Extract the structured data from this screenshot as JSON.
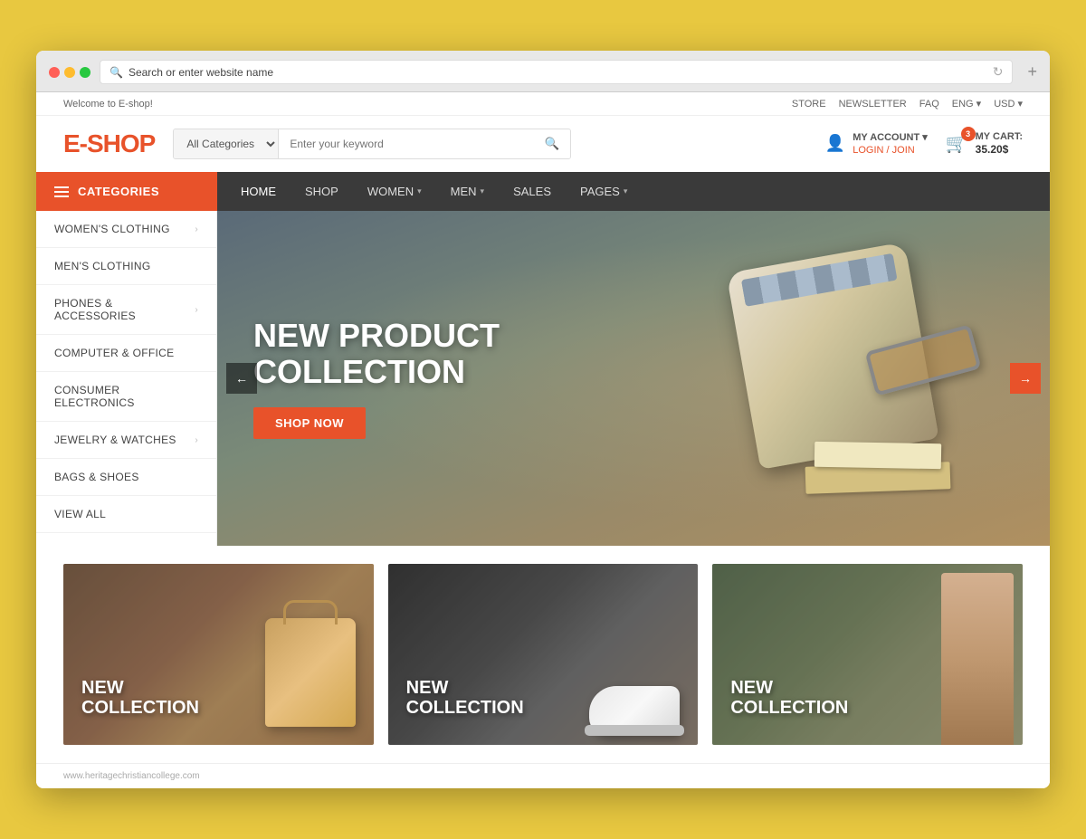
{
  "browser": {
    "url": "Search or enter website name"
  },
  "topbar": {
    "welcome": "Welcome to E-shop!",
    "store": "STORE",
    "newsletter": "NEWSLETTER",
    "faq": "FAQ",
    "lang": "ENG",
    "currency": "USD"
  },
  "header": {
    "logo_e": "E-",
    "logo_shop": "SHOP",
    "category_default": "All Categories",
    "search_placeholder": "Enter your keyword",
    "account_label": "MY ACCOUNT",
    "account_sub": "LOGIN / JOIN",
    "cart_label": "MY CART:",
    "cart_price": "35.20$",
    "cart_count": "3"
  },
  "nav": {
    "categories": "CATEGORIES",
    "links": [
      {
        "label": "HOME",
        "has_arrow": false
      },
      {
        "label": "SHOP",
        "has_arrow": false
      },
      {
        "label": "WOMEN",
        "has_arrow": true
      },
      {
        "label": "MEN",
        "has_arrow": true
      },
      {
        "label": "SALES",
        "has_arrow": false
      },
      {
        "label": "PAGES",
        "has_arrow": true
      }
    ]
  },
  "sidebar": {
    "items": [
      {
        "label": "WOMEN'S CLOTHING",
        "has_arrow": true
      },
      {
        "label": "MEN'S CLOTHING",
        "has_arrow": false
      },
      {
        "label": "PHONES & ACCESSORIES",
        "has_arrow": true
      },
      {
        "label": "COMPUTER & OFFICE",
        "has_arrow": false
      },
      {
        "label": "CONSUMER ELECTRONICS",
        "has_arrow": false
      },
      {
        "label": "JEWELRY & WATCHES",
        "has_arrow": true
      },
      {
        "label": "BAGS & SHOES",
        "has_arrow": false
      },
      {
        "label": "VIEW ALL",
        "has_arrow": false
      }
    ]
  },
  "hero": {
    "title": "NEW PRODUCT COLLECTION",
    "btn_label": "SHOP NOW"
  },
  "promo_cards": [
    {
      "title": "NEW\nCOLLECTION",
      "type": "bags"
    },
    {
      "title": "NEW\nCOLLECTION",
      "type": "shoes"
    },
    {
      "title": "NEW\nCOLLECTION",
      "type": "person"
    }
  ],
  "footer": {
    "url": "www.heritagechristiancollege.com"
  }
}
